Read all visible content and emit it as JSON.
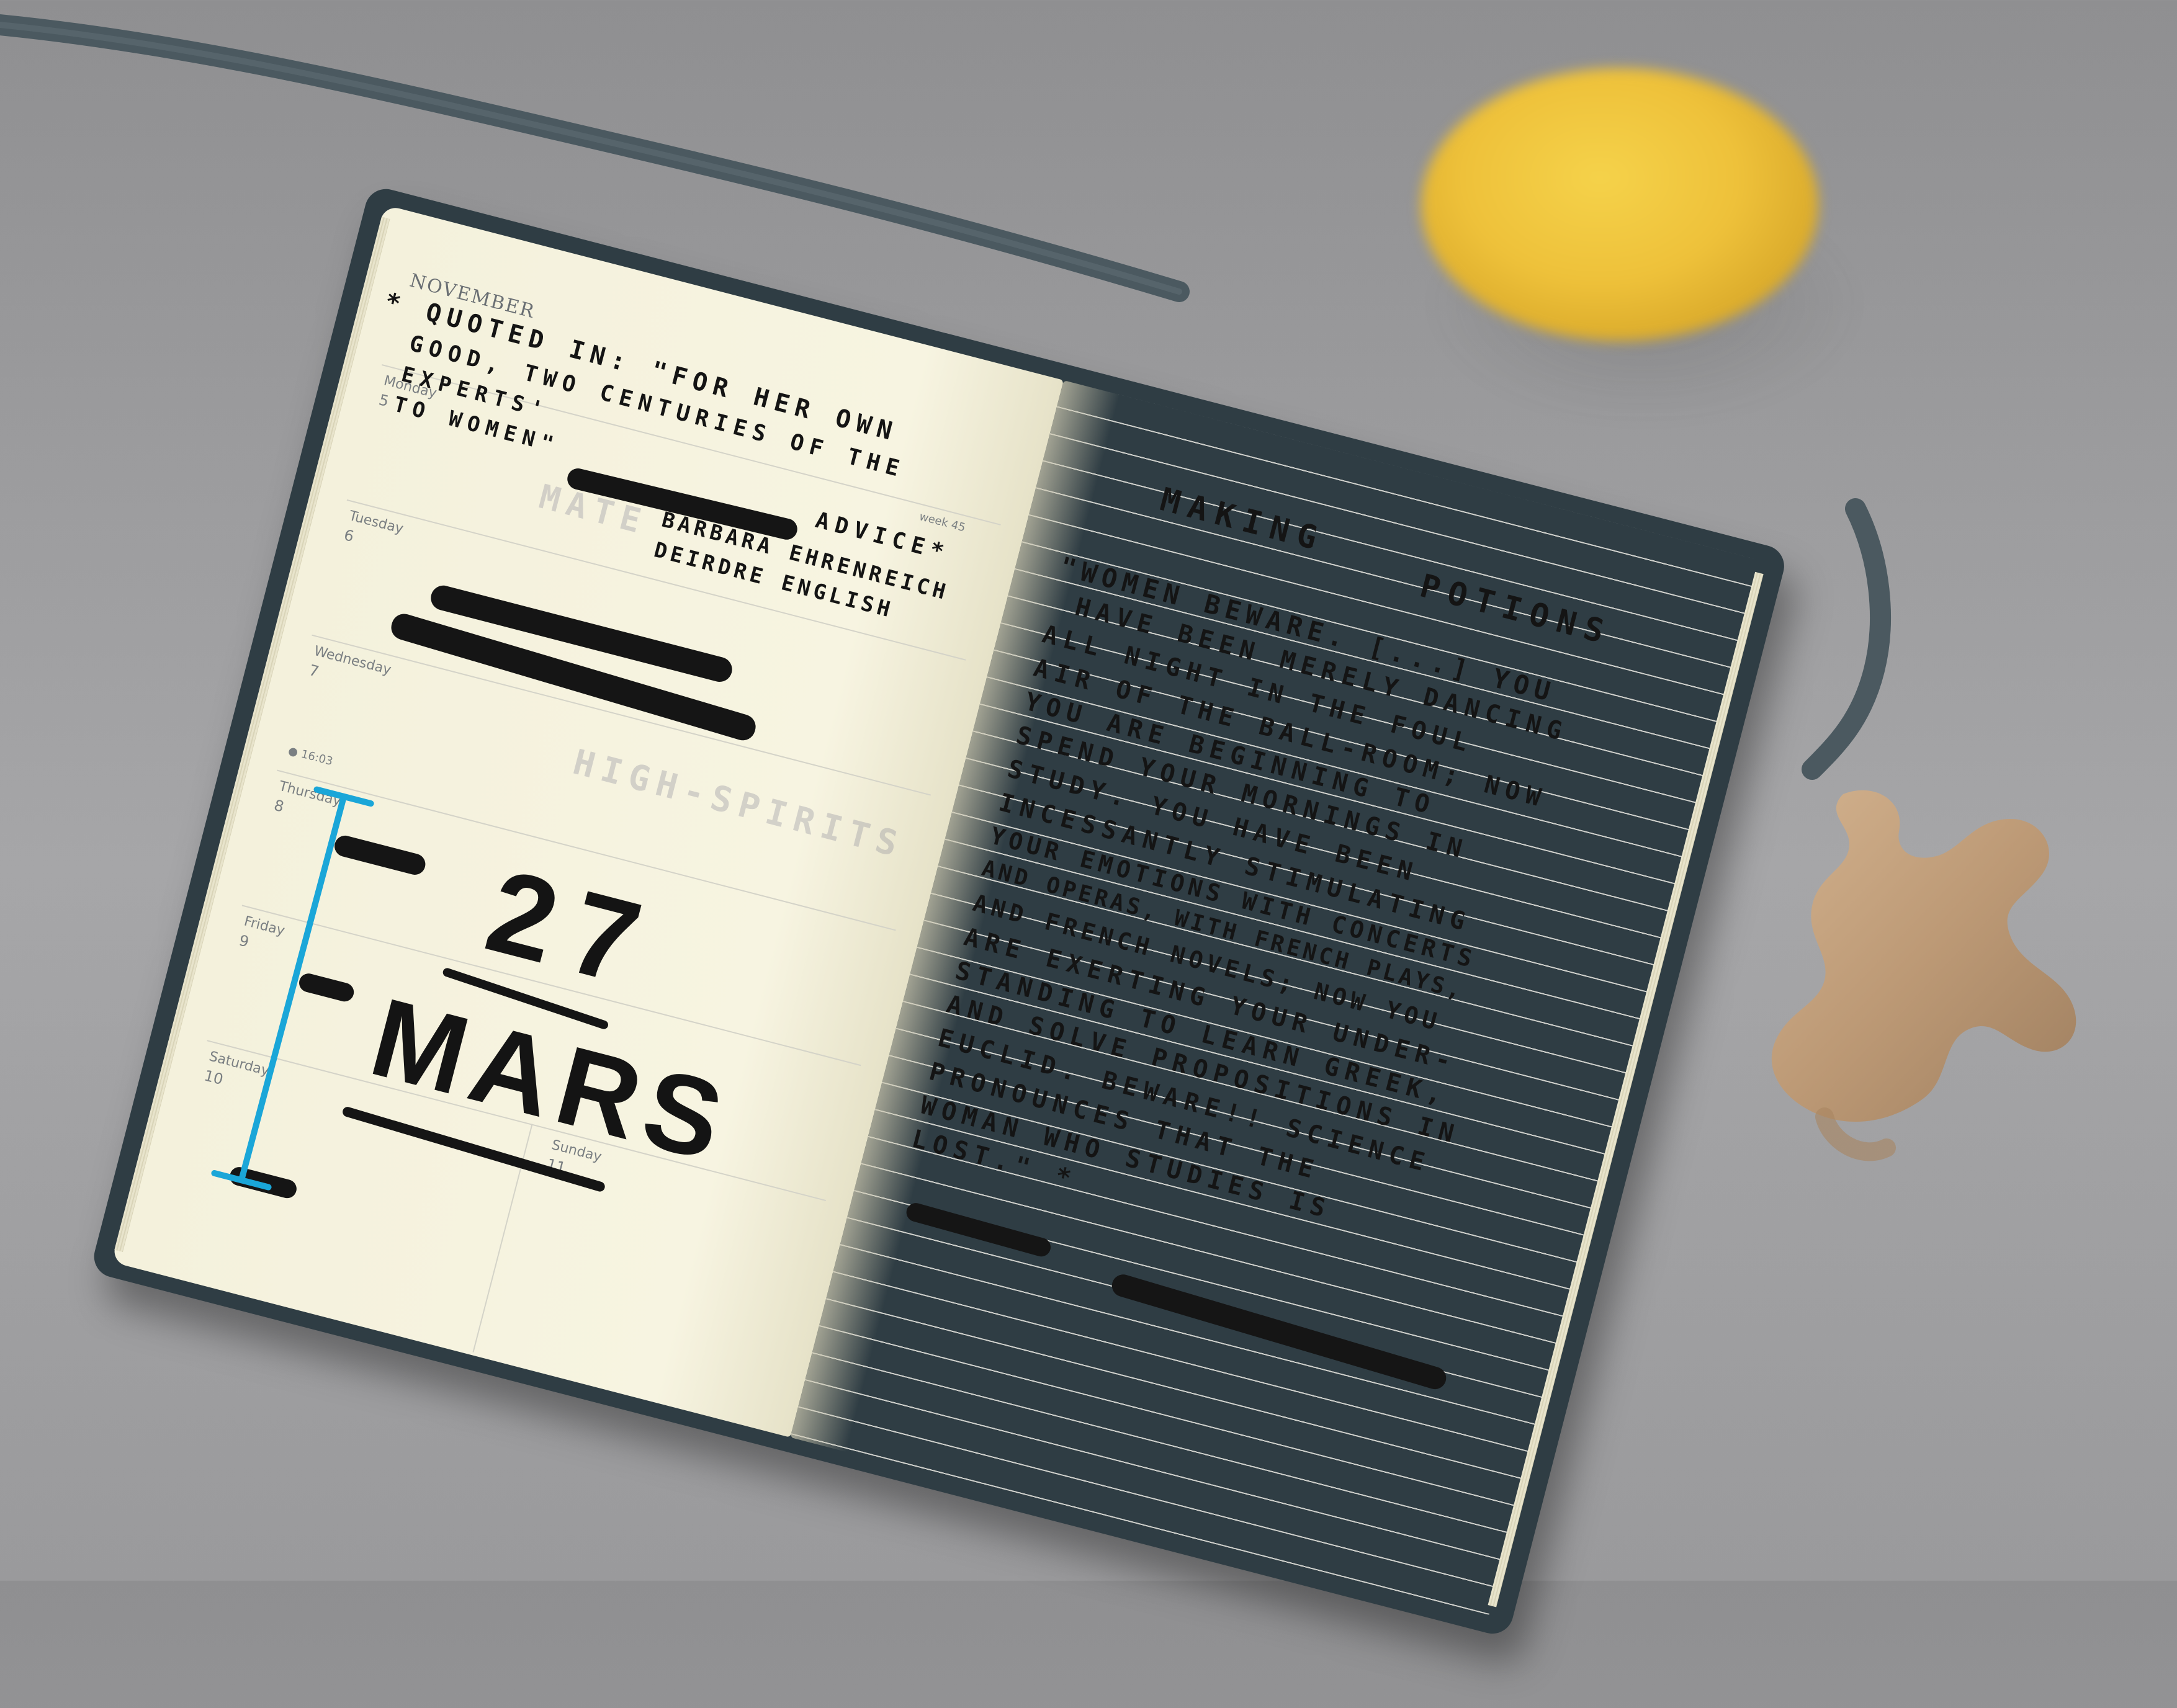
{
  "left_page": {
    "month": "NOVEMBER",
    "week": "week 45",
    "days": [
      {
        "name": "Monday",
        "num": "5"
      },
      {
        "name": "Tuesday",
        "num": "6"
      },
      {
        "name": "Wednesday",
        "num": "7"
      },
      {
        "name": "Thursday",
        "num": "8"
      },
      {
        "name": "Friday",
        "num": "9"
      },
      {
        "name": "Saturday",
        "num": "10"
      },
      {
        "name": "Sunday",
        "num": "11"
      }
    ],
    "moon_time": "16:03",
    "quote_lines": [
      "* QUOTED IN: \"FOR HER OWN",
      "GOOD, TWO CENTURIES OF THE",
      "EXPERTS'",
      "TO WOMEN\"",
      "ADVICE*",
      "BARBARA EHRENREICH",
      "DEIRDRE ENGLISH"
    ],
    "big_number": "27",
    "big_word": "MARS"
  },
  "right_page": {
    "title_line1": "MAKING",
    "title_line2": "POTIONS",
    "body_lines": [
      "\"WOMEN BEWARE. [...] YOU",
      "HAVE BEEN MERELY DANCING",
      "ALL NIGHT IN THE FOUL",
      "AIR OF THE BALL-ROOM; NOW",
      "YOU ARE BEGINNING TO",
      "SPEND YOUR MORNINGS IN",
      "STUDY. YOU HAVE BEEN",
      "INCESSANTLY STIMULATING",
      "YOUR EMOTIONS WITH CONCERTS",
      "AND OPERAS, WITH FRENCH PLAYS,",
      "AND FRENCH NOVELS; NOW YOU",
      "ARE EXERTING YOUR UNDER-",
      "STANDING TO LEARN GREEK,",
      "AND SOLVE PROPOSITIONS IN",
      "EUCLID. BEWARE!! SCIENCE",
      "PRONOUNCES THAT THE",
      "WOMAN WHO STUDIES IS",
      "LOST.\" *"
    ]
  },
  "colors": {
    "background": "#9c9c9e",
    "cover": "#2f3d44",
    "paper": "#f6f3df",
    "ink": "#141414",
    "blue_bracket": "#1aa6d8",
    "lemon": "#eec13a",
    "ginger": "#c9a27a"
  }
}
